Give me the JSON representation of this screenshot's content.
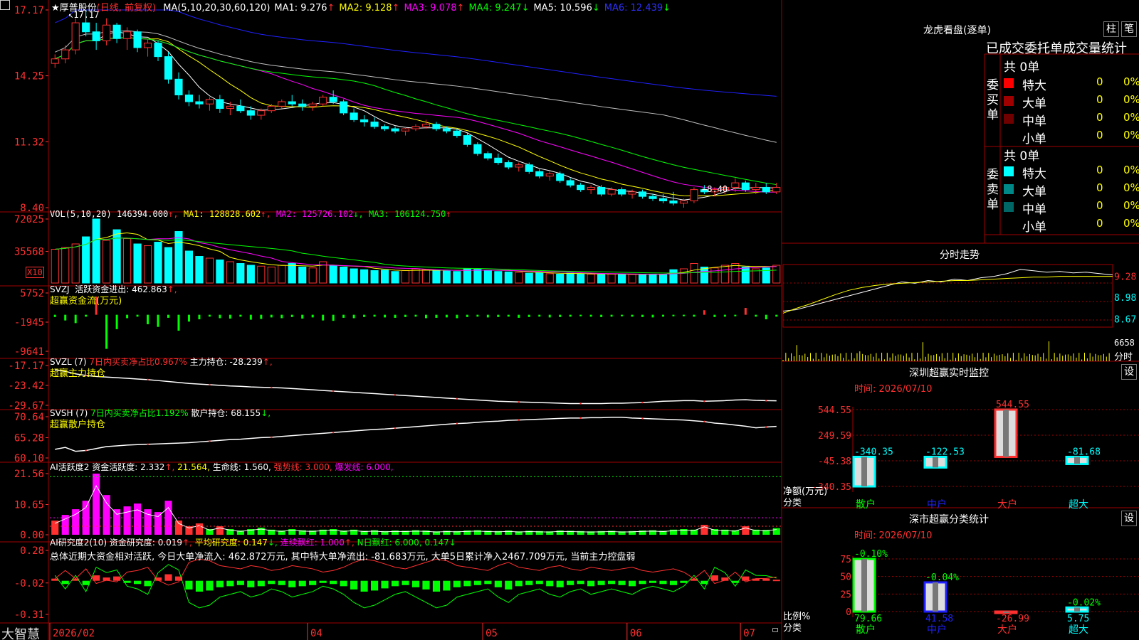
{
  "colors": {
    "up": "#ff3030",
    "down": "#00ffff",
    "ma1": "#ffffff",
    "ma2": "#ffff00",
    "ma3": "#ff00ff",
    "ma4": "#00ff00",
    "ma5": "#c0c0c0",
    "ma6": "#2020ff",
    "grid": "#a00000",
    "green": "#00ff00"
  },
  "app": {
    "brand": "大智慧",
    "menu_icon": "menu-square-icon",
    "lock_icon": "lock-icon"
  },
  "header": {
    "star": "★",
    "stock_name": "厚普股份",
    "period": "(日线, 前复权)",
    "ma_items": [
      {
        "label": "MA(5,10,20,30,60,120)",
        "color": "#ffffff",
        "arrow": ""
      },
      {
        "label": "MA1: 9.276",
        "color": "#ffffff",
        "arrow": "↑"
      },
      {
        "label": "MA2: 9.128",
        "color": "#ffff00",
        "arrow": "↑"
      },
      {
        "label": "MA3: 9.078",
        "color": "#ff00ff",
        "arrow": "↑"
      },
      {
        "label": "MA4: 9.247",
        "color": "#00ff00",
        "arrow": "↓"
      },
      {
        "label": "MA5: 10.596",
        "color": "#ffffff",
        "arrow": "↓"
      },
      {
        "label": "MA6: 12.439",
        "color": "#3030ff",
        "arrow": "↓"
      }
    ]
  },
  "price_axis": [
    "17.17",
    "14.25",
    "11.32",
    "8.40"
  ],
  "price_labels": {
    "high": "17.17",
    "low": "8.40"
  },
  "vol": {
    "label": "VOL(5,10,20)",
    "value": "146394.000",
    "ma1": "MA1: 128828.602",
    "ma2": "MA2: 125726.102",
    "ma3": "MA3: 106124.750",
    "axis": [
      "72025",
      "35568"
    ],
    "unit": "X10"
  },
  "svzj": {
    "label": "SVZJ",
    "title": "活跃资金进出: 462.863",
    "arrow": "↑,",
    "subtitle": "超赢资金流(万元)",
    "axis": [
      "5752",
      "-1945",
      "-9641"
    ]
  },
  "svzl": {
    "label": "SVZL (7)",
    "ratio": "7日内买卖净占比0.967%",
    "hold": "主力持仓: -28.239",
    "arrow": "↑,",
    "subtitle": "超赢主力持仓",
    "axis": [
      "-17.17",
      "-23.42",
      "-29.67"
    ]
  },
  "svsh": {
    "label": "SVSH (7)",
    "ratio": "7日内买卖净占比1.192%",
    "hold": "散户持仓: 68.155",
    "arrow": "↓,",
    "subtitle": "超赢散户持仓",
    "axis": [
      "70.64",
      "65.28",
      "60.10"
    ]
  },
  "ai1": {
    "label": "AI活跃度2",
    "active": "资金活跃度: 2.332",
    "a2": "21.564,",
    "life": "生命线: 1.560,",
    "strong": "强势线: 3.000,",
    "burst": "爆发线: 6.000,",
    "axis": [
      "21.56",
      "10.65",
      "0.00"
    ]
  },
  "ai2": {
    "label": "AI研究度2(10)",
    "research": "资金研究度: 0.019",
    "avg": "平均研究度: 0.147",
    "redc": "连续飘红: 1.000",
    "nred": "N日飘红: 6.000, 0.147",
    "summary": "总体近期大资金相对活跃, 今日大单净流入: 462.872万元, 其中特大单净流出: -81.683万元, 大单5日累计净入2467.709万元, 当前主力控盘弱",
    "axis": [
      "0.28",
      "-0.02",
      "-0.31"
    ]
  },
  "date_axis": [
    "2026/02",
    "04",
    "05",
    "06",
    "07"
  ],
  "dragon": {
    "title": "龙虎看盘(逐单)",
    "btn_bar": "柱",
    "btn_pen": "笔",
    "subtitle": "已成交委托单成交量统计",
    "buy_label": "委买单",
    "sell_label": "委卖单",
    "buy_total": "共 0单",
    "sell_total": "共 0单",
    "buy_rows": [
      {
        "name": "特大",
        "count": "0",
        "pct": "0%",
        "color": "#ff0000"
      },
      {
        "name": "大单",
        "count": "0",
        "pct": "0%",
        "color": "#a00000"
      },
      {
        "name": "中单",
        "count": "0",
        "pct": "0%",
        "color": "#700000"
      },
      {
        "name": "小单",
        "count": "0",
        "pct": "0%",
        "color": "#000000"
      }
    ],
    "sell_rows": [
      {
        "name": "特大",
        "count": "0",
        "pct": "0%",
        "color": "#00ffff"
      },
      {
        "name": "大单",
        "count": "0",
        "pct": "0%",
        "color": "#008888"
      },
      {
        "name": "中单",
        "count": "0",
        "pct": "0%",
        "color": "#006666"
      },
      {
        "name": "小单",
        "count": "0",
        "pct": "0%",
        "color": "#000000"
      }
    ]
  },
  "timeshare": {
    "title": "分时走势",
    "axis": [
      "9.28",
      "8.98",
      "8.67"
    ],
    "vol_label": "6658",
    "vol_unit": "分时"
  },
  "monitor": {
    "title": "深圳超赢实时监控",
    "btn": "设",
    "time": "时间: 2026/07/10",
    "axis": [
      "544.55",
      "249.59",
      "-45.38",
      "-340.35"
    ],
    "net_label": "净额(万元)",
    "class_label": "分类"
  },
  "classify": {
    "title": "深市超赢分类统计",
    "btn": "设",
    "time": "时间: 2026/07/10",
    "axis": [
      "75",
      "50",
      "25",
      "0"
    ],
    "ratio_label": "比例%",
    "class_label": "分类"
  },
  "chart_data": [
    {
      "type": "candlestick",
      "title": "厚普股份 (日线, 前复权)",
      "high_marker": 17.17,
      "low_marker": 8.4,
      "ylim": [
        8.4,
        17.17
      ],
      "ohlc": [
        [
          14.8,
          15.2,
          14.6,
          15.0
        ],
        [
          15.0,
          15.6,
          14.8,
          15.4
        ],
        [
          15.4,
          16.8,
          15.2,
          16.6
        ],
        [
          16.6,
          17.17,
          16.0,
          16.2
        ],
        [
          16.2,
          16.6,
          15.4,
          15.8
        ],
        [
          15.8,
          16.8,
          15.6,
          16.5
        ],
        [
          16.5,
          16.6,
          15.7,
          15.9
        ],
        [
          15.9,
          16.4,
          15.4,
          16.2
        ],
        [
          16.2,
          16.3,
          15.3,
          15.5
        ],
        [
          15.5,
          15.9,
          15.1,
          15.7
        ],
        [
          15.7,
          15.8,
          14.9,
          15.1
        ],
        [
          15.1,
          15.3,
          13.9,
          14.1
        ],
        [
          14.1,
          14.4,
          13.2,
          13.4
        ],
        [
          13.4,
          13.6,
          12.9,
          13.1
        ],
        [
          13.1,
          13.4,
          12.8,
          13.0
        ],
        [
          13.0,
          13.3,
          12.7,
          13.2
        ],
        [
          13.2,
          13.4,
          12.6,
          12.8
        ],
        [
          12.8,
          13.1,
          12.5,
          12.9
        ],
        [
          12.9,
          13.2,
          12.6,
          12.7
        ],
        [
          12.7,
          12.9,
          12.3,
          12.5
        ],
        [
          12.5,
          12.8,
          12.3,
          12.7
        ],
        [
          12.7,
          13.0,
          12.6,
          12.9
        ],
        [
          12.9,
          13.2,
          12.8,
          13.1
        ],
        [
          13.1,
          13.4,
          12.9,
          13.0
        ],
        [
          13.0,
          13.2,
          12.7,
          12.9
        ],
        [
          12.9,
          13.1,
          12.7,
          13.0
        ],
        [
          13.0,
          13.4,
          12.9,
          13.3
        ],
        [
          13.3,
          13.6,
          13.0,
          13.1
        ],
        [
          13.1,
          13.2,
          12.5,
          12.6
        ],
        [
          12.6,
          12.8,
          12.2,
          12.3
        ],
        [
          12.3,
          12.5,
          12.0,
          12.2
        ],
        [
          12.2,
          12.4,
          11.9,
          12.0
        ],
        [
          12.0,
          12.1,
          11.8,
          11.9
        ],
        [
          11.9,
          12.0,
          11.7,
          11.8
        ],
        [
          11.8,
          12.0,
          11.6,
          11.9
        ],
        [
          11.9,
          12.1,
          11.8,
          12.0
        ],
        [
          12.0,
          12.3,
          11.9,
          12.1
        ],
        [
          12.1,
          12.2,
          11.8,
          11.9
        ],
        [
          11.9,
          12.0,
          11.7,
          11.8
        ],
        [
          11.8,
          11.9,
          11.5,
          11.6
        ],
        [
          11.6,
          11.7,
          11.1,
          11.2
        ],
        [
          11.2,
          11.3,
          10.7,
          10.8
        ],
        [
          10.8,
          10.9,
          10.5,
          10.6
        ],
        [
          10.6,
          10.8,
          10.3,
          10.4
        ],
        [
          10.4,
          10.5,
          10.1,
          10.2
        ],
        [
          10.2,
          10.4,
          10.0,
          10.3
        ],
        [
          10.3,
          10.4,
          9.9,
          10.0
        ],
        [
          10.0,
          10.1,
          9.7,
          9.8
        ],
        [
          9.8,
          10.0,
          9.6,
          9.9
        ],
        [
          9.9,
          10.0,
          9.5,
          9.6
        ],
        [
          9.6,
          9.7,
          9.3,
          9.4
        ],
        [
          9.4,
          9.5,
          9.1,
          9.2
        ],
        [
          9.2,
          9.4,
          9.0,
          9.3
        ],
        [
          9.3,
          9.4,
          8.9,
          9.0
        ],
        [
          9.0,
          9.3,
          8.9,
          9.2
        ],
        [
          9.2,
          9.3,
          8.9,
          9.0
        ],
        [
          9.0,
          9.2,
          8.8,
          9.1
        ],
        [
          9.1,
          9.2,
          8.8,
          8.9
        ],
        [
          8.9,
          9.0,
          8.7,
          8.8
        ],
        [
          8.8,
          9.0,
          8.6,
          8.7
        ],
        [
          8.7,
          9.1,
          8.5,
          8.6
        ],
        [
          8.6,
          8.8,
          8.4,
          8.7
        ],
        [
          8.7,
          9.3,
          8.6,
          9.2
        ],
        [
          9.2,
          9.4,
          9.0,
          9.1
        ],
        [
          9.1,
          9.3,
          8.9,
          9.2
        ],
        [
          9.2,
          9.4,
          9.0,
          9.3
        ],
        [
          9.3,
          9.7,
          9.1,
          9.5
        ],
        [
          9.5,
          9.6,
          9.1,
          9.2
        ],
        [
          9.2,
          9.5,
          9.0,
          9.3
        ],
        [
          9.3,
          9.5,
          9.0,
          9.1
        ],
        [
          9.1,
          9.5,
          9.0,
          9.3
        ]
      ]
    },
    {
      "type": "bar",
      "title": "VOL(5,10,20)",
      "ylim": [
        0,
        72025
      ],
      "values": [
        38000,
        40000,
        44000,
        52000,
        72025,
        48000,
        60000,
        50000,
        44000,
        42000,
        46000,
        40000,
        58000,
        36000,
        30000,
        28000,
        26000,
        24000,
        22000,
        20000,
        19000,
        18000,
        20000,
        22000,
        18000,
        17000,
        24000,
        20000,
        18000,
        16000,
        15000,
        14000,
        14500,
        13000,
        14000,
        16000,
        15000,
        14000,
        13500,
        13000,
        16000,
        15500,
        14000,
        13000,
        12500,
        12000,
        11000,
        11500,
        10500,
        10000,
        11000,
        10500,
        10000,
        9500,
        10000,
        9800,
        9600,
        9400,
        10000,
        9800,
        15000,
        16000,
        22000,
        18000,
        17000,
        20000,
        22000,
        18000,
        16000,
        17000,
        20000
      ]
    },
    {
      "type": "bar",
      "title": "超赢资金流(万元)",
      "ylim": [
        -9641,
        5752
      ],
      "values": [
        -600,
        -1500,
        -2200,
        -500,
        4800,
        -9000,
        -3800,
        -900,
        -500,
        -2500,
        -3200,
        -800,
        -4200,
        -1800,
        -1200,
        -500,
        -900,
        -1000,
        -500,
        -1300,
        -1100,
        -700,
        -900,
        -600,
        -1000,
        -700,
        -1500,
        -1600,
        -800,
        -900,
        -600,
        -500,
        -700,
        -800,
        -600,
        -500,
        -900,
        -800,
        -700,
        -900,
        -600,
        -500,
        -700,
        -600,
        -500,
        -800,
        -600,
        -500,
        -700,
        -600,
        -500,
        -400,
        -500,
        -600,
        -500,
        -400,
        -500,
        -600,
        -700,
        -500,
        -400,
        -300,
        -500,
        1200,
        -600,
        -500,
        -400,
        1800,
        -500,
        -1200,
        -500
      ]
    },
    {
      "type": "line",
      "title": "超赢主力持仓",
      "ylim": [
        -29.67,
        -17.17
      ],
      "values": [
        -18.5,
        -19.0,
        -19.8,
        -20.3,
        -20.6,
        -20.8,
        -21.0,
        -21.2,
        -21.4,
        -21.6,
        -21.9,
        -22.2,
        -22.5,
        -22.8,
        -23.0,
        -23.2,
        -23.4,
        -23.6,
        -23.7,
        -23.9,
        -24.0,
        -24.1,
        -24.2,
        -24.4,
        -24.6,
        -24.8,
        -25.0,
        -25.2,
        -25.4,
        -25.6,
        -25.8,
        -26.0,
        -26.2,
        -26.4,
        -26.6,
        -26.8,
        -27.0,
        -27.2,
        -27.4,
        -27.6,
        -27.8,
        -28.0,
        -28.2,
        -28.4,
        -28.5,
        -28.6,
        -28.7,
        -28.8,
        -28.9,
        -29.0,
        -29.1,
        -29.1,
        -29.1,
        -29.1,
        -29.0,
        -29.0,
        -28.9,
        -28.8,
        -28.6,
        -28.4,
        -28.3,
        -28.2,
        -28.2,
        -28.4,
        -28.3,
        -28.2,
        -28.0,
        -27.9,
        -28.1,
        -28.2,
        -28.239
      ]
    },
    {
      "type": "line",
      "title": "超赢散户持仓",
      "ylim": [
        60.1,
        70.64
      ],
      "values": [
        62.3,
        62.8,
        61.8,
        62.0,
        62.5,
        63.0,
        63.2,
        63.4,
        63.5,
        63.6,
        63.7,
        63.8,
        63.9,
        64.0,
        64.2,
        64.4,
        64.6,
        64.8,
        64.9,
        65.1,
        65.3,
        65.4,
        65.6,
        65.8,
        66.0,
        66.2,
        66.4,
        66.6,
        66.8,
        67.0,
        67.2,
        67.4,
        67.5,
        67.7,
        67.9,
        68.1,
        68.3,
        68.5,
        68.7,
        68.9,
        69.0,
        69.2,
        69.4,
        69.5,
        69.7,
        69.8,
        69.9,
        70.0,
        70.1,
        70.2,
        70.3,
        70.3,
        70.4,
        70.4,
        70.5,
        70.5,
        70.3,
        70.2,
        70.1,
        70.0,
        69.9,
        69.8,
        69.6,
        69.4,
        69.0,
        68.8,
        68.5,
        68.2,
        67.8,
        68.0,
        68.155
      ]
    },
    {
      "type": "bar",
      "title": "AI活跃度2",
      "ylim": [
        0,
        21.56
      ],
      "values": [
        5,
        7,
        9,
        12,
        21.56,
        14,
        9,
        10,
        11,
        9,
        8,
        12,
        5,
        3,
        4,
        2,
        3,
        2,
        1.5,
        2,
        2.5,
        1.8,
        1.5,
        2,
        1.6,
        1.5,
        1.8,
        2,
        1.5,
        1.8,
        1.4,
        1.6,
        1.3,
        1.5,
        1.4,
        1.6,
        1.5,
        1.2,
        1.4,
        1.3,
        1.5,
        1.6,
        1.4,
        1.3,
        1.5,
        1.2,
        1.4,
        1.3,
        1.2,
        1.5,
        1.4,
        1.3,
        1.2,
        1.3,
        1.4,
        1.2,
        1.3,
        1.5,
        1.6,
        1.4,
        1.8,
        2.0,
        1.8,
        3.5,
        2.0,
        1.8,
        1.6,
        3.0,
        1.8,
        1.7,
        2.332
      ]
    },
    {
      "type": "bar",
      "title": "AI研究度2(10)",
      "ylim": [
        -0.31,
        0.28
      ],
      "values": [
        0.02,
        -0.03,
        0.02,
        -0.04,
        0.05,
        0.03,
        0.04,
        -0.02,
        -0.03,
        -0.05,
        0.03,
        0.06,
        0.04,
        -0.08,
        -0.1,
        -0.09,
        -0.06,
        -0.05,
        -0.04,
        -0.06,
        -0.05,
        -0.03,
        -0.04,
        -0.06,
        -0.05,
        -0.04,
        -0.02,
        -0.03,
        -0.05,
        -0.08,
        -0.1,
        -0.09,
        -0.07,
        -0.05,
        -0.04,
        -0.06,
        -0.08,
        -0.1,
        -0.09,
        -0.06,
        -0.05,
        -0.04,
        -0.03,
        -0.06,
        -0.08,
        -0.05,
        -0.04,
        -0.03,
        -0.05,
        -0.06,
        -0.04,
        -0.03,
        -0.05,
        -0.04,
        -0.03,
        -0.04,
        -0.05,
        -0.03,
        -0.02,
        -0.03,
        -0.04,
        -0.02,
        0.02,
        -0.03,
        0.05,
        0.03,
        -0.02,
        0.04,
        0.02,
        0.019,
        0.01
      ]
    },
    {
      "type": "line",
      "title": "分时走势",
      "ylim": [
        8.55,
        9.45
      ],
      "values": [
        8.78,
        8.8,
        8.85,
        8.9,
        8.95,
        9.0,
        9.05,
        9.1,
        9.15,
        9.2,
        9.18,
        9.22,
        9.2,
        9.24,
        9.22,
        9.26,
        9.28,
        9.32,
        9.38,
        9.36,
        9.34,
        9.35,
        9.33,
        9.34,
        9.32,
        9.3
      ],
      "avg": [
        8.75,
        8.82,
        8.88,
        8.95,
        9.02,
        9.08,
        9.12,
        9.15,
        9.17,
        9.18,
        9.19,
        9.2,
        9.21,
        9.22,
        9.22,
        9.23,
        9.24,
        9.25,
        9.26,
        9.27,
        9.27,
        9.28,
        9.28,
        9.28,
        9.28,
        9.28
      ]
    },
    {
      "type": "bar",
      "title": "深圳超赢实时监控",
      "categories": [
        "散户",
        "中户",
        "大户",
        "超大"
      ],
      "values": [
        -340.35,
        -122.53,
        544.55,
        -81.68
      ],
      "labels": [
        "-340.35",
        "-122.53",
        "544.55",
        "-81.68"
      ],
      "ylim": [
        -340.35,
        544.55
      ]
    },
    {
      "type": "bar",
      "title": "深市超赢分类统计",
      "categories": [
        "散户",
        "中户",
        "大户",
        "超大"
      ],
      "values": [
        79.66,
        41.58,
        -26.99,
        5.75
      ],
      "labels": [
        "79.66",
        "41.58",
        "-26.99",
        "5.75"
      ],
      "top_labels": [
        "-0.10%",
        "-0.04%",
        "",
        "-0.02%"
      ],
      "ylim": [
        0,
        75
      ]
    }
  ]
}
